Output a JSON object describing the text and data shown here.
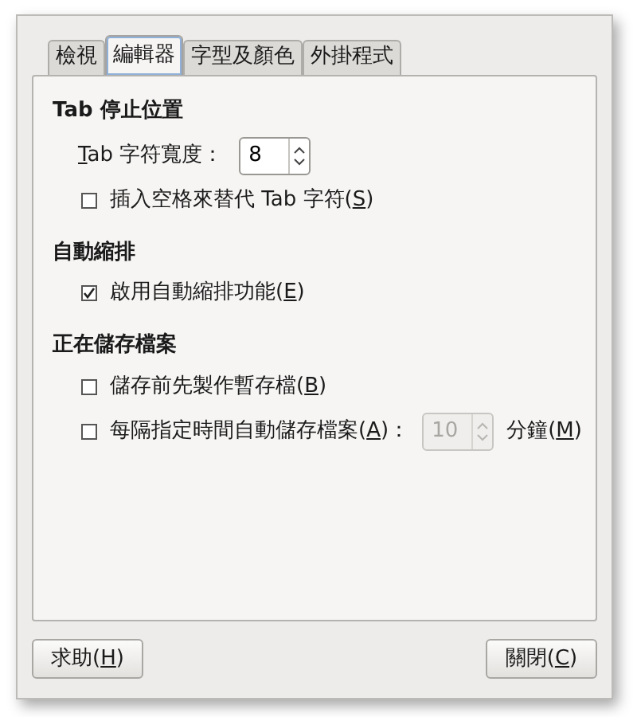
{
  "tabs": [
    {
      "label": "檢視",
      "selected": false
    },
    {
      "label": "編輯器",
      "selected": true
    },
    {
      "label": "字型及顏色",
      "selected": false
    },
    {
      "label": "外掛程式",
      "selected": false
    }
  ],
  "sections": [
    {
      "title": "Tab 停止位置",
      "items": [
        {
          "kind": "spin",
          "label": {
            "key": "T",
            "after": "ab 字符寬度："
          },
          "value": "8",
          "disabled": false
        },
        {
          "kind": "checkbox",
          "label": {
            "before": "插入空格來替代 Tab 字符(",
            "key": "S",
            "after": ")"
          },
          "checked": false
        }
      ]
    },
    {
      "title": "自動縮排",
      "items": [
        {
          "kind": "checkbox",
          "label": {
            "before": "啟用自動縮排功能(",
            "key": "E",
            "after": ")"
          },
          "checked": true
        }
      ]
    },
    {
      "title": "正在儲存檔案",
      "items": [
        {
          "kind": "checkbox",
          "label": {
            "before": "儲存前先製作暫存檔(",
            "key": "B",
            "after": ")"
          },
          "checked": false
        },
        {
          "kind": "checkbox-spin",
          "label": {
            "before": "每隔指定時間自動儲存檔案(",
            "key": "A",
            "after": ")："
          },
          "checked": false,
          "value": "10",
          "disabled": true,
          "unit": {
            "before": "分鐘(",
            "key": "M",
            "after": ")"
          }
        }
      ]
    }
  ],
  "buttons": [
    {
      "label": {
        "before": "求助(",
        "key": "H",
        "after": ")"
      }
    },
    {
      "label": {
        "before": "關閉(",
        "key": "C",
        "after": ")"
      }
    }
  ]
}
